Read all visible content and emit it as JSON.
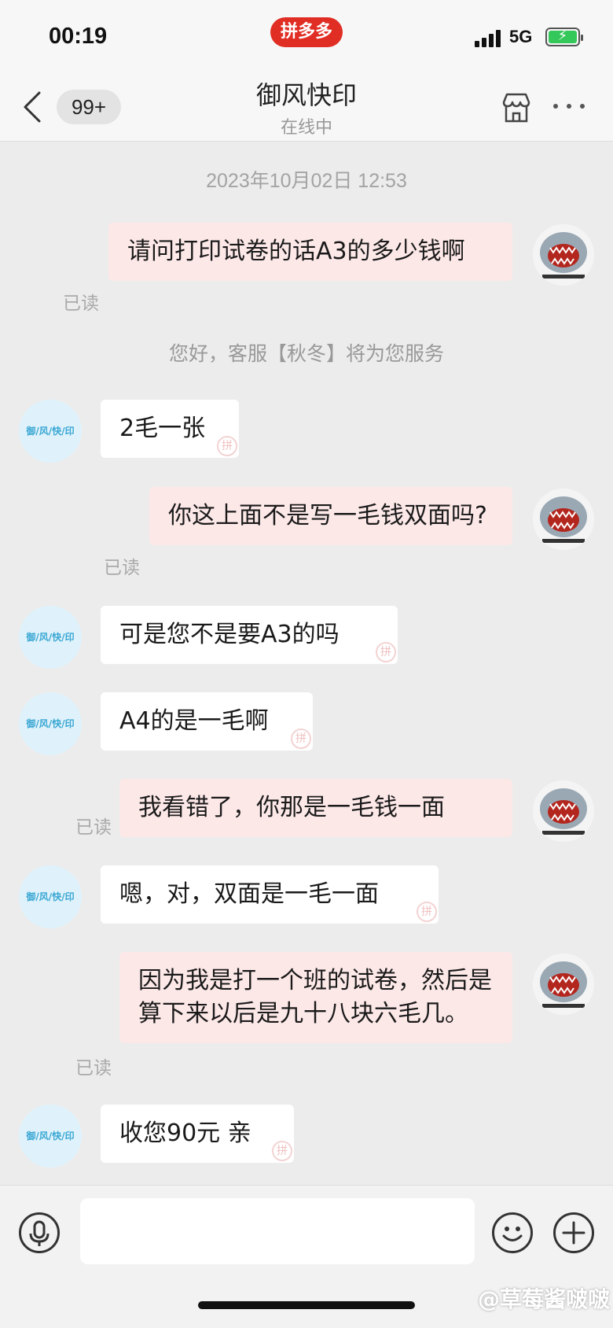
{
  "status_bar": {
    "time": "00:19",
    "app_badge": "拼多多",
    "network": "5G"
  },
  "header": {
    "back_icon": "chevron-left-icon",
    "unread_count": "99+",
    "shop_name": "御风快印",
    "shop_status": "在线中",
    "store_icon": "store-icon",
    "more_icon": "more-icon"
  },
  "chat": {
    "timestamp": "2023年10月02日 12:53",
    "system_message": "您好，客服【秋冬】将为您服务",
    "read_label": "已读",
    "shop_avatar_text": "御/风/快/印",
    "pdd_mark": "拼",
    "messages": [
      {
        "from": "user",
        "text": "请问打印试卷的话A3的多少钱啊",
        "read": "已读"
      },
      {
        "from": "shop",
        "text": "2毛一张"
      },
      {
        "from": "user",
        "text": "你这上面不是写一毛钱双面吗?",
        "read": "已读"
      },
      {
        "from": "shop",
        "text": "可是您不是要A3的吗"
      },
      {
        "from": "shop",
        "text": "A4的是一毛啊"
      },
      {
        "from": "user",
        "text": "我看错了，你那是一毛钱一面",
        "read": "已读"
      },
      {
        "from": "shop",
        "text": "嗯，对，双面是一毛一面"
      },
      {
        "from": "user",
        "text": "因为我是打一个班的试卷，然后是算下来以后是九十八块六毛几。",
        "read": "已读"
      },
      {
        "from": "shop",
        "text": "收您90元 亲"
      }
    ]
  },
  "input_bar": {
    "voice_icon": "microphone-icon",
    "emoji_icon": "smiley-icon",
    "plus_icon": "plus-icon",
    "placeholder": ""
  },
  "watermark": "@草莓酱啵啵",
  "colors": {
    "brand": "#e02e24",
    "outgoing_bubble": "#fde8e8",
    "incoming_bubble": "#ffffff",
    "chat_background": "#ececec"
  }
}
